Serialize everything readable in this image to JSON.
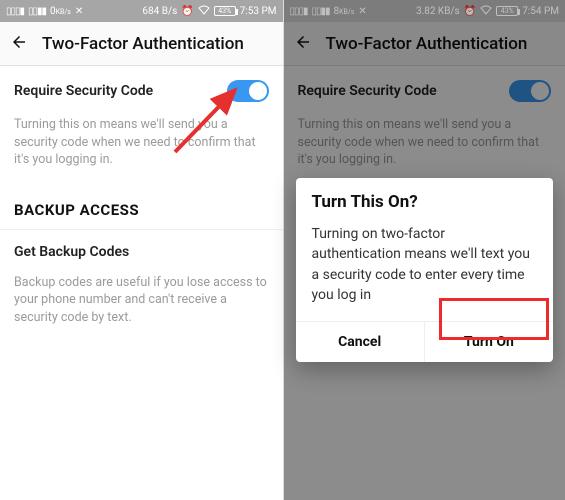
{
  "left": {
    "status": {
      "speed": "684 B/s",
      "kbs": "0",
      "battery": "43%",
      "time": "7:53 PM"
    },
    "title": "Two-Factor Authentication",
    "toggle_label": "Require Security Code",
    "toggle_desc": "Turning this on means we'll send you a security code when we need to confirm that it's you logging in.",
    "backup_header": "BACKUP ACCESS",
    "backup_link": "Get Backup Codes",
    "backup_desc": "Backup codes are useful if you lose access to your phone number and can't receive a security code by text."
  },
  "right": {
    "status": {
      "speed": "3.82 KB/s",
      "kbs": "8",
      "battery": "43%",
      "time": "7:54 PM"
    },
    "title": "Two-Factor Authentication",
    "toggle_label": "Require Security Code",
    "toggle_desc": "Turning this on means we'll send you a security code when we need to confirm that it's you logging in.",
    "dialog": {
      "title": "Turn This On?",
      "body": "Turning on two-factor authentication means we'll text you a security code to enter every time you log in",
      "cancel": "Cancel",
      "confirm": "Turn On"
    }
  }
}
